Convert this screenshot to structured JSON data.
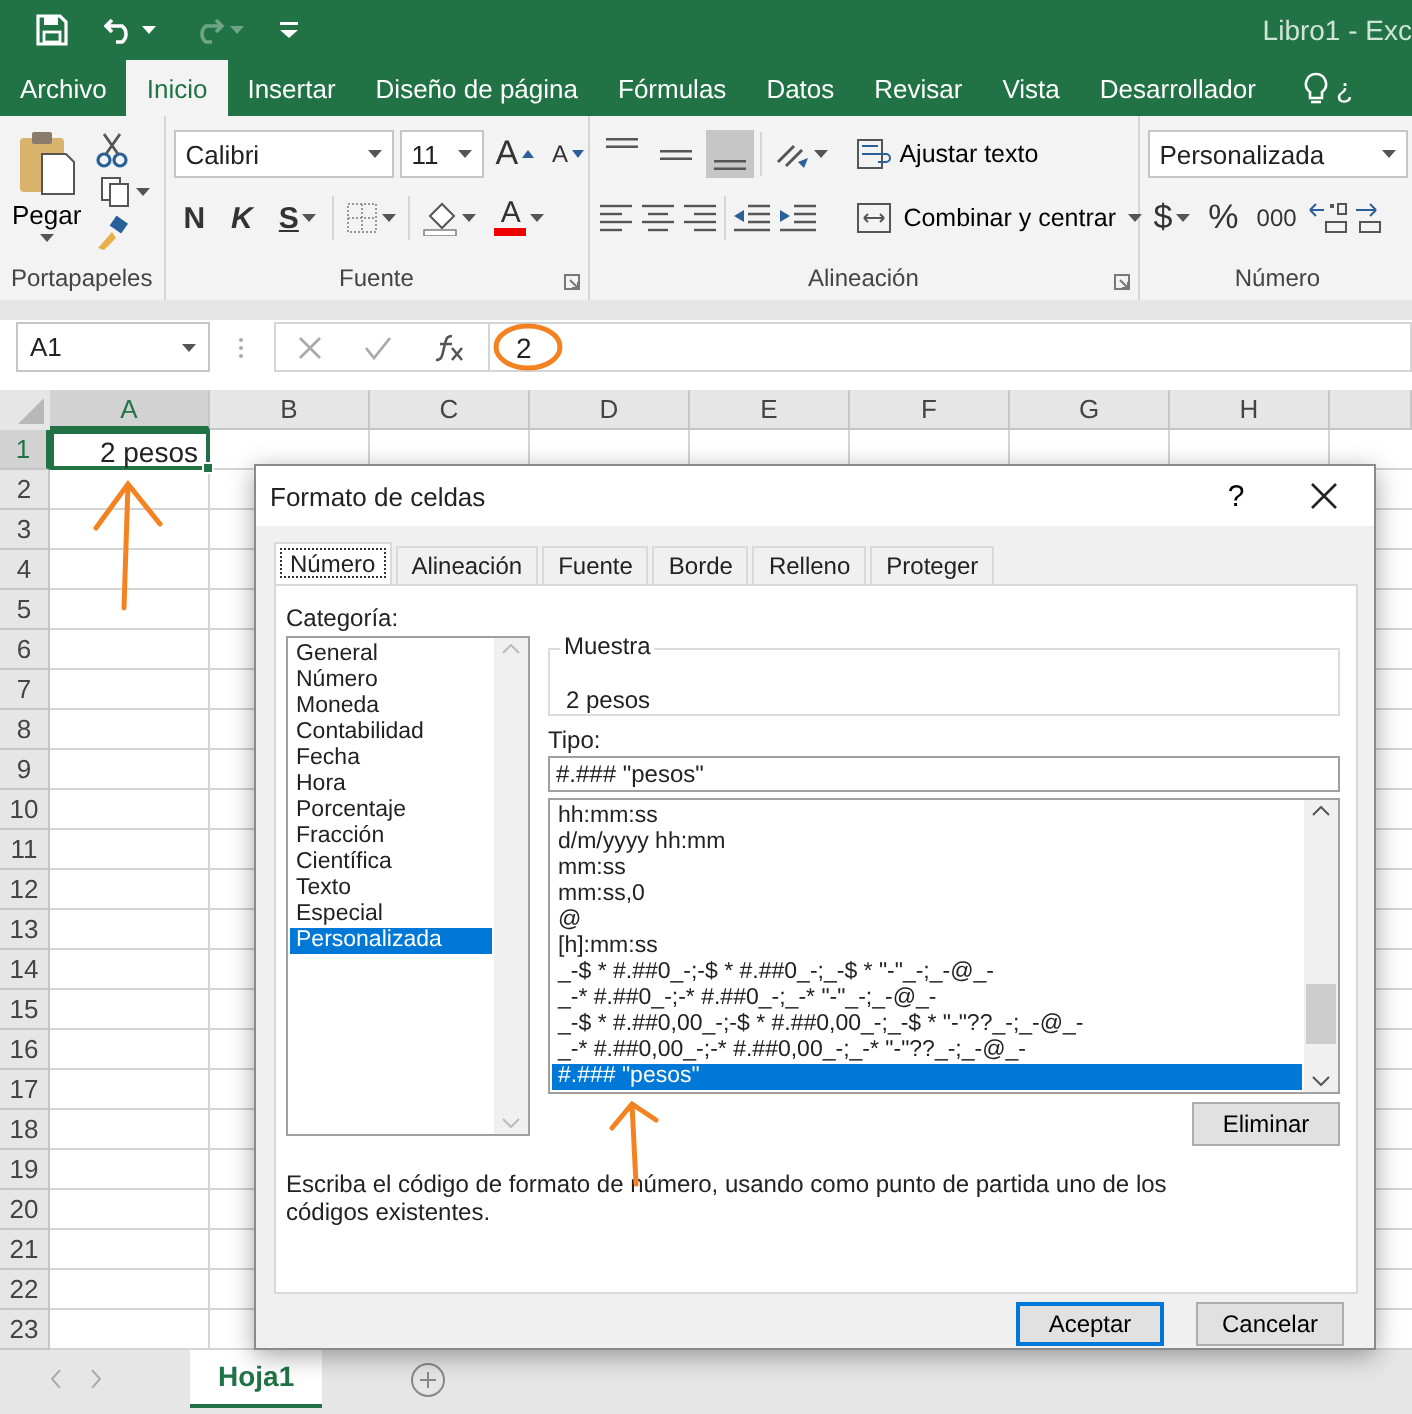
{
  "window": {
    "title": "Libro1 - Exc"
  },
  "ribbon_tabs": [
    {
      "label": "Archivo",
      "selected": false
    },
    {
      "label": "Inicio",
      "selected": true
    },
    {
      "label": "Insertar",
      "selected": false
    },
    {
      "label": "Diseño de página",
      "selected": false
    },
    {
      "label": "Fórmulas",
      "selected": false
    },
    {
      "label": "Datos",
      "selected": false
    },
    {
      "label": "Revisar",
      "selected": false
    },
    {
      "label": "Vista",
      "selected": false
    },
    {
      "label": "Desarrollador",
      "selected": false
    }
  ],
  "tell_me": "¿",
  "ribbon": {
    "clipboard": {
      "paste": "Pegar",
      "label": "Portapapeles"
    },
    "font": {
      "name": "Calibri",
      "size": "11",
      "grow": "A",
      "shrink": "A",
      "bold": "N",
      "italic": "K",
      "underline": "S",
      "color_letter": "A",
      "label": "Fuente"
    },
    "alignment": {
      "vertical_align_buttons": [
        {
          "selected": false
        },
        {
          "selected": false
        },
        {
          "selected": true
        }
      ],
      "wrap": "Ajustar texto",
      "merge": "Combinar y centrar",
      "label": "Alineación"
    },
    "number": {
      "format": "Personalizada",
      "currency": "$",
      "percent": "%",
      "thousands": "000",
      "label": "Número"
    }
  },
  "formula_bar": {
    "name_box": "A1",
    "value": "2"
  },
  "sheet": {
    "columns": [
      "A",
      "B",
      "C",
      "D",
      "E",
      "F",
      "G",
      "H"
    ],
    "rows": [
      {
        "header": "1",
        "cells": [
          {
            "value": "2 pesos",
            "selected": true
          }
        ]
      },
      {
        "header": "2"
      },
      {
        "header": "3"
      },
      {
        "header": "4"
      },
      {
        "header": "5"
      },
      {
        "header": "6"
      },
      {
        "header": "7"
      },
      {
        "header": "8"
      },
      {
        "header": "9"
      },
      {
        "header": "10"
      },
      {
        "header": "11"
      },
      {
        "header": "12"
      },
      {
        "header": "13"
      },
      {
        "header": "14"
      },
      {
        "header": "15"
      },
      {
        "header": "16"
      },
      {
        "header": "17"
      },
      {
        "header": "18"
      },
      {
        "header": "19"
      },
      {
        "header": "20"
      },
      {
        "header": "21"
      },
      {
        "header": "22"
      },
      {
        "header": "23"
      }
    ]
  },
  "sheet_tabs": [
    {
      "label": "Hoja1",
      "selected": true
    }
  ],
  "dialog": {
    "title": "Formato de celdas",
    "help": "?",
    "tabs": [
      {
        "label": "Número",
        "selected": true
      },
      {
        "label": "Alineación",
        "selected": false
      },
      {
        "label": "Fuente",
        "selected": false
      },
      {
        "label": "Borde",
        "selected": false
      },
      {
        "label": "Relleno",
        "selected": false
      },
      {
        "label": "Proteger",
        "selected": false
      }
    ],
    "category_label": "Categoría:",
    "categories": [
      {
        "label": "General",
        "selected": false
      },
      {
        "label": "Número",
        "selected": false
      },
      {
        "label": "Moneda",
        "selected": false
      },
      {
        "label": "Contabilidad",
        "selected": false
      },
      {
        "label": "Fecha",
        "selected": false
      },
      {
        "label": "Hora",
        "selected": false
      },
      {
        "label": "Porcentaje",
        "selected": false
      },
      {
        "label": "Fracción",
        "selected": false
      },
      {
        "label": "Científica",
        "selected": false
      },
      {
        "label": "Texto",
        "selected": false
      },
      {
        "label": "Especial",
        "selected": false
      },
      {
        "label": "Personalizada",
        "selected": true
      }
    ],
    "sample_label": "Muestra",
    "sample": "2 pesos",
    "type_label": "Tipo:",
    "type_value": "#.### \"pesos\"",
    "formats": [
      {
        "label": "hh:mm:ss",
        "selected": false
      },
      {
        "label": "d/m/yyyy hh:mm",
        "selected": false
      },
      {
        "label": "mm:ss",
        "selected": false
      },
      {
        "label": "mm:ss,0",
        "selected": false
      },
      {
        "label": "@",
        "selected": false
      },
      {
        "label": "[h]:mm:ss",
        "selected": false
      },
      {
        "label": "_-$ * #.##0_-;-$ * #.##0_-;_-$ * \"-\"_-;_-@_-",
        "selected": false
      },
      {
        "label": "_-* #.##0_-;-* #.##0_-;_-* \"-\"_-;_-@_-",
        "selected": false
      },
      {
        "label": "_-$ * #.##0,00_-;-$ * #.##0,00_-;_-$ * \"-\"??_-;_-@_-",
        "selected": false
      },
      {
        "label": "_-* #.##0,00_-;-* #.##0,00_-;_-* \"-\"??_-;_-@_-",
        "selected": false
      },
      {
        "label": "#.### \"pesos\"",
        "selected": true
      }
    ],
    "delete_button": "Eliminar",
    "description": "Escriba el código de formato de número, usando como punto de partida uno de los códigos existentes.",
    "buttons": [
      {
        "label": "Aceptar",
        "default": true
      },
      {
        "label": "Cancelar",
        "default": false
      }
    ]
  }
}
